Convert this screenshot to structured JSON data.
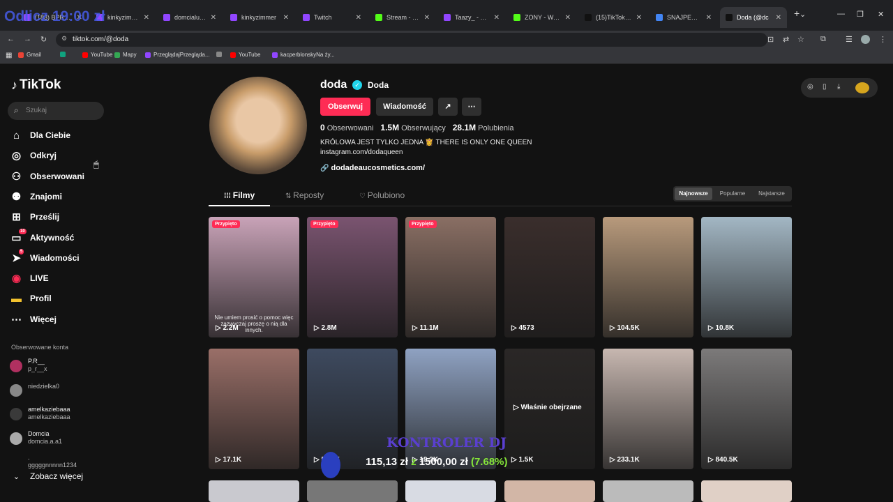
{
  "browser": {
    "tabs": [
      {
        "label": "(183) BPRZO",
        "color": "#9146ff"
      },
      {
        "label": "kinkyzimmer",
        "color": "#9146ff"
      },
      {
        "label": "domcialupinski",
        "color": "#9146ff"
      },
      {
        "label": "kinkyzimmer",
        "color": "#9146ff"
      },
      {
        "label": "Twitch",
        "color": "#9146ff"
      },
      {
        "label": "Stream - Kick",
        "color": "#53fc18"
      },
      {
        "label": "Taazy_ - Twitch",
        "color": "#9146ff"
      },
      {
        "label": "ZONY - Watch",
        "color": "#53fc18"
      },
      {
        "label": "(15)TikTok - M",
        "color": "#111111"
      },
      {
        "label": "SNAJPER WÓD",
        "color": "#4285f4"
      },
      {
        "label": "Doda (@dc",
        "color": "#111111",
        "active": true
      }
    ],
    "url": "tiktok.com/@doda",
    "bookmarks": [
      {
        "label": "Gmail",
        "icon": "gmail-icon"
      },
      {
        "label": "",
        "icon": "chatgpt-icon"
      },
      {
        "label": "YouTube",
        "icon": "youtube-icon"
      },
      {
        "label": "Mapy",
        "icon": "maps-icon"
      },
      {
        "label": "PrzeglądajPrzegląda...",
        "icon": "twitch-icon"
      },
      {
        "label": "",
        "icon": "globe-icon"
      },
      {
        "label": "YouTube",
        "icon": "youtube-icon"
      },
      {
        "label": "kacperblonskyNa ży...",
        "icon": "twitch-icon"
      }
    ]
  },
  "sidebar": {
    "logo": "TikTok",
    "search_placeholder": "Szukaj",
    "nav": [
      {
        "label": "Dla Ciebie",
        "icon": "home-icon"
      },
      {
        "label": "Odkryj",
        "icon": "compass-icon"
      },
      {
        "label": "Obserwowani",
        "icon": "following-icon"
      },
      {
        "label": "Znajomi",
        "icon": "friends-icon"
      },
      {
        "label": "Prześlij",
        "icon": "upload-icon"
      },
      {
        "label": "Aktywność",
        "icon": "activity-icon",
        "badge": "10"
      },
      {
        "label": "Wiadomości",
        "icon": "messages-icon",
        "badge": "5"
      },
      {
        "label": "LIVE",
        "icon": "live-icon"
      },
      {
        "label": "Profil",
        "icon": "profile-icon"
      },
      {
        "label": "Więcej",
        "icon": "more-icon"
      }
    ],
    "following_header": "Obserwowane konta",
    "accounts": [
      {
        "name": "P.R__",
        "handle": "p_r__x"
      },
      {
        "name": "",
        "handle": "niedzielka0"
      },
      {
        "name": "amelkaziebaaa",
        "handle": "amelkaziebaaa"
      },
      {
        "name": "Domcia",
        "handle": "domcia.a.a1"
      },
      {
        "name": ".",
        "handle": "gggggnnnnn1234"
      }
    ],
    "see_more": "Zobacz więcej"
  },
  "profile": {
    "username": "doda",
    "nickname": "Doda",
    "follow_label": "Obserwuj",
    "message_label": "Wiadomość",
    "stats": [
      {
        "value": "0",
        "label": "Obserwowani"
      },
      {
        "value": "1.5M",
        "label": "Obserwujący"
      },
      {
        "value": "28.1M",
        "label": "Polubienia"
      }
    ],
    "bio_line1": "KRÓLOWA JEST TYLKO JEDNA 👸 THERE IS ONLY ONE QUEEN",
    "bio_line2": "instagram.com/dodaqueen",
    "link": "dodadeaucosmetics.com/"
  },
  "content_tabs": [
    {
      "label": "Filmy",
      "icon": "grid-icon"
    },
    {
      "label": "Reposty",
      "icon": "repost-icon"
    },
    {
      "label": "Polubiono",
      "icon": "heart-icon"
    }
  ],
  "sort": {
    "options": [
      "Najnowsze",
      "Popularne",
      "Najstarsze"
    ],
    "selected": "Najnowsze"
  },
  "videos": [
    {
      "views": "2.2M",
      "pinned": "Przypięto",
      "caption": "Nie umiem prosić o pomoc więc zazwyczaj proszę o nią dla innych.",
      "bg": "#c9a3b8"
    },
    {
      "views": "2.8M",
      "pinned": "Przypięto",
      "bg": "#7a5470"
    },
    {
      "views": "11.1M",
      "pinned": "Przypięto",
      "bg": "#8a6f64"
    },
    {
      "views": "4573",
      "bg": "#3a2e2c"
    },
    {
      "views": "104.5K",
      "bg": "#b89a7c"
    },
    {
      "views": "10.8K",
      "bg": "#a3b7c4"
    },
    {
      "views": "17.1K",
      "bg": "#9a6f68"
    },
    {
      "views": "50.6K",
      "bg": "#3e4a5f"
    },
    {
      "views": "19.3K",
      "bg": "#8fa2c2"
    },
    {
      "views": "1.5K",
      "watched": "Właśnie obejrzane",
      "bg": "#2a2726"
    },
    {
      "views": "233.1K",
      "bg": "#c7b7b0"
    },
    {
      "views": "840.5K",
      "bg": "#7c7a7a"
    }
  ],
  "overlay": {
    "top_text": "Odlicz 19:00 zł",
    "controller": "KONTROLER DJ",
    "money_amount": "115,13 zł",
    "money_sep": "z",
    "money_goal": "1500,00 zł",
    "money_percent": "(7.68%)"
  }
}
